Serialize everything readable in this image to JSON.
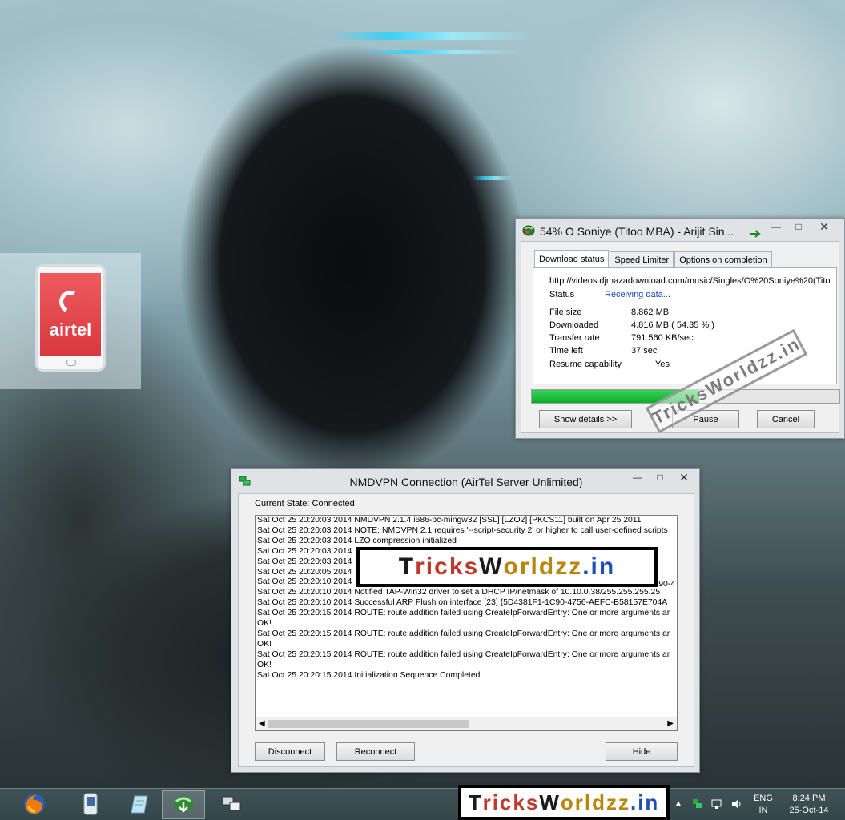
{
  "idm": {
    "title": "54% O Soniye (Titoo MBA) - Arijit Sin...",
    "tabs": [
      "Download status",
      "Speed Limiter",
      "Options on completion"
    ],
    "url": "http://videos.djmazadownload.com/music/Singles/O%20Soniye%20(Titoo",
    "status_label": "Status",
    "status_value": "Receiving data...",
    "rows": [
      {
        "label": "File size",
        "value": "8.862  MB"
      },
      {
        "label": "Downloaded",
        "value": "4.816  MB  ( 54.35 % )"
      },
      {
        "label": "Transfer rate",
        "value": "791.560  KB/sec"
      },
      {
        "label": "Time left",
        "value": "37 sec"
      },
      {
        "label": "Resume capability",
        "value": "Yes"
      }
    ],
    "progress_fraction": 0.5435,
    "buttons": {
      "details": "Show details >>",
      "pause": "Pause",
      "cancel": "Cancel"
    },
    "accent": "#08b02c"
  },
  "vpn": {
    "title": "NMDVPN Connection (AirTel Server Unlimited)",
    "current_state": "Current State: Connected",
    "log": [
      "Sat Oct 25 20:20:03 2014 NMDVPN 2.1.4 i686-pc-mingw32 [SSL] [LZO2] [PKCS11] built on Apr 25 2011",
      "Sat Oct 25 20:20:03 2014 NOTE: NMDVPN 2.1 requires '--script-security 2' or higher to call user-defined scripts",
      "Sat Oct 25 20:20:03 2014 LZO compression initialized",
      "Sat Oct 25 20:20:03 2014",
      "Sat Oct 25 20:20:03 2014",
      "Sat Oct 25 20:20:05 2014",
      "Sat Oct 25 20:20:10 2014",
      "Sat Oct 25 20:20:10 2014 Notified TAP-Win32 driver to set a DHCP IP/netmask of 10.10.0.38/255.255.255.25",
      "Sat Oct 25 20:20:10 2014 Successful ARP Flush on interface [23] {5D4381F1-1C90-4756-AEFC-B58157E704A",
      "Sat Oct 25 20:20:15 2014 ROUTE: route addition failed using CreateIpForwardEntry: One or more arguments ar",
      " OK!",
      "Sat Oct 25 20:20:15 2014 ROUTE: route addition failed using CreateIpForwardEntry: One or more arguments ar",
      " OK!",
      "Sat Oct 25 20:20:15 2014 ROUTE: route addition failed using CreateIpForwardEntry: One or more arguments ar",
      " OK!",
      "Sat Oct 25 20:20:15 2014 Initialization Sequence Completed"
    ],
    "log_tail_fragment": "90-4",
    "buttons": {
      "disconnect": "Disconnect",
      "reconnect": "Reconnect",
      "hide": "Hide"
    }
  },
  "watermark": {
    "text": "TricksWorldzz.in",
    "parts": [
      {
        "t": "T",
        "c": "#1a1a1a"
      },
      {
        "t": "ricks",
        "c": "#c0392b"
      },
      {
        "t": "W",
        "c": "#1a1a1a"
      },
      {
        "t": "orldzz",
        "c": "#b8860b"
      },
      {
        "t": ".in",
        "c": "#1f4fb5"
      }
    ]
  },
  "desktop": {
    "airtel_label": "airtel"
  },
  "taskbar": {
    "apps": [
      "firefox-icon",
      "mobile-partner-icon",
      "notepad-icon",
      "idm-icon",
      "network-icon"
    ],
    "language": "ENG",
    "region": "IN",
    "time": "8:24 PM",
    "date": "25-Oct-14"
  }
}
